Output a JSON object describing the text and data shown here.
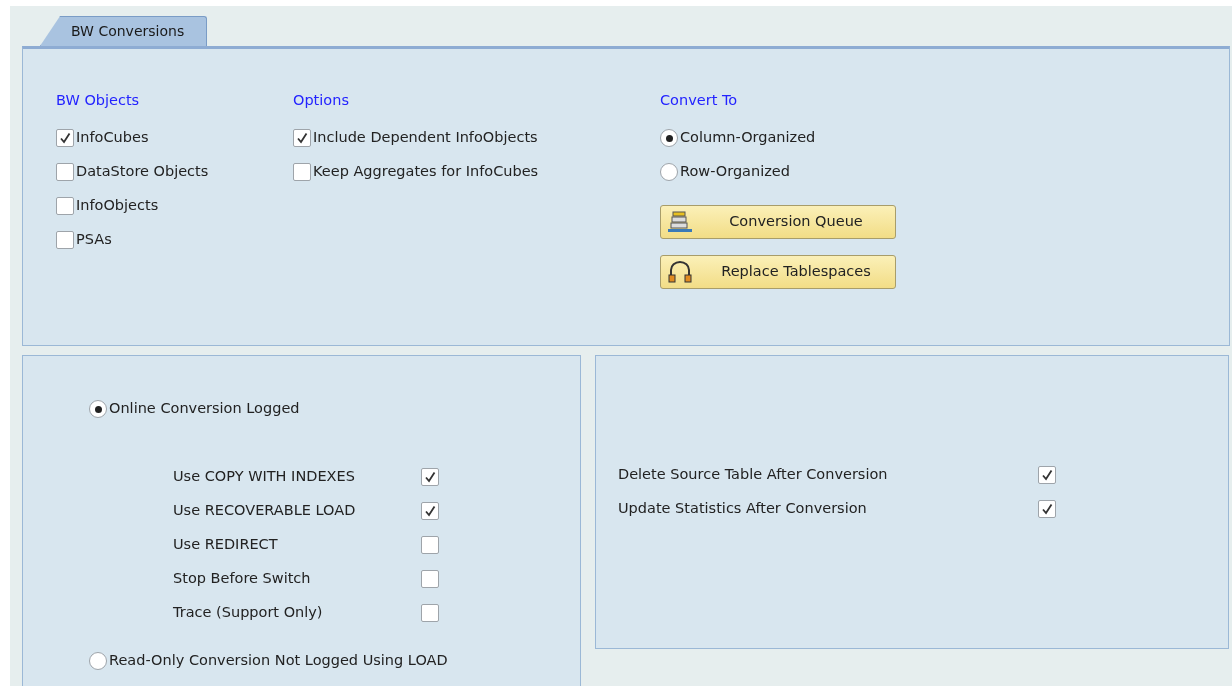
{
  "tabs": [
    {
      "label": "BW Conversions",
      "selected": true
    }
  ],
  "bw_objects": {
    "title": "BW Objects",
    "items": [
      {
        "label": "InfoCubes",
        "checked": true
      },
      {
        "label": "DataStore Objects",
        "checked": false
      },
      {
        "label": "InfoObjects",
        "checked": false
      },
      {
        "label": "PSAs",
        "checked": false
      }
    ]
  },
  "options": {
    "title": "Options",
    "items": [
      {
        "label": "Include Dependent InfoObjects",
        "checked": true
      },
      {
        "label": "Keep Aggregates for InfoCubes",
        "checked": false
      }
    ]
  },
  "convert_to": {
    "title": "Convert To",
    "choices": [
      {
        "label": "Column-Organized",
        "selected": true
      },
      {
        "label": "Row-Organized",
        "selected": false
      }
    ]
  },
  "buttons": [
    {
      "label": "Conversion Queue",
      "kind": "queue"
    },
    {
      "label": "Replace Tablespaces",
      "kind": "tablespaces"
    }
  ],
  "conversion_modes": [
    {
      "label": "Online Conversion Logged",
      "selected": true,
      "settings": [
        {
          "label": "Use COPY WITH INDEXES",
          "checked": true
        },
        {
          "label": "Use RECOVERABLE LOAD",
          "checked": true
        },
        {
          "label": "Use REDIRECT",
          "checked": false
        },
        {
          "label": "Stop Before Switch",
          "checked": false
        },
        {
          "label": "Trace (Support Only)",
          "checked": false
        }
      ]
    },
    {
      "label": "Read-Only Conversion Not Logged Using LOAD",
      "selected": false
    }
  ],
  "after_conversion": [
    {
      "label": "Delete Source Table After Conversion",
      "checked": true
    },
    {
      "label": "Update Statistics After Conversion",
      "checked": true
    }
  ]
}
